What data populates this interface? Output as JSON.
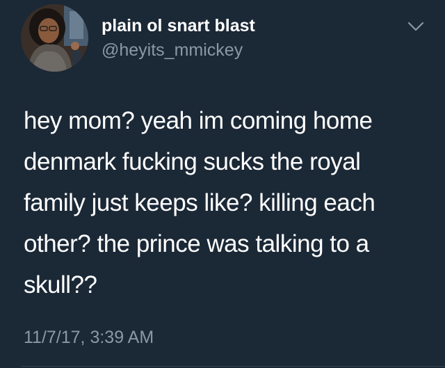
{
  "tweet": {
    "author": {
      "display_name": "plain ol snart blast",
      "handle": "@heyits_mmickey"
    },
    "text_lines": [
      "hey mom? yeah im coming home",
      "denmark fucking sucks the royal",
      "family just keeps like? killing each",
      "other? the prince was talking to a",
      "skull??"
    ],
    "timestamp": "11/7/17, 3:39 AM"
  },
  "icons": {
    "menu": "chevron-down-icon",
    "avatar": "profile-photo"
  },
  "colors": {
    "background": "#1b2836",
    "primary_text": "#ffffff",
    "secondary_text": "#8b98a5",
    "divider": "#38444d"
  }
}
